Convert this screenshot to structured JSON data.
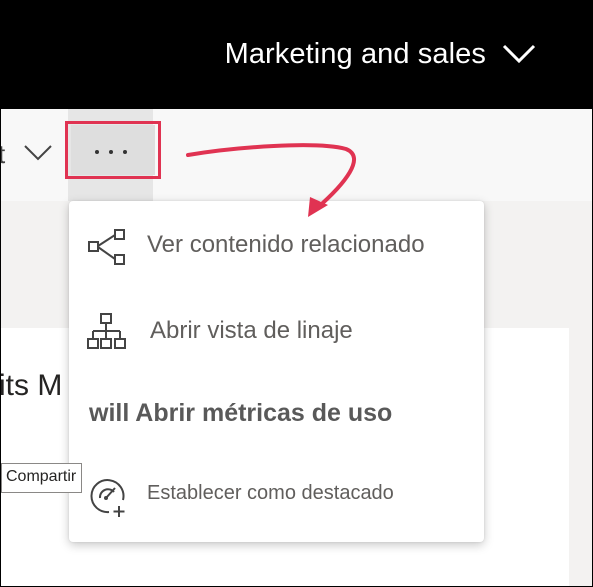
{
  "header": {
    "workspace_title": "Marketing and sales",
    "workspace_chevron_icon": "chevron-down-icon"
  },
  "toolbar": {
    "partial_text": "t",
    "more_options_icon": "ellipsis-icon",
    "chevron_icon": "chevron-down-icon"
  },
  "report": {
    "title_partial": "its M"
  },
  "tooltip": {
    "text": "Compartir"
  },
  "menu": {
    "items": [
      {
        "label": "Ver contenido relacionado",
        "icon": "share-network-icon"
      },
      {
        "label": "Abrir vista de linaje",
        "icon": "hierarchy-icon"
      },
      {
        "label": "will Abrir métricas de uso",
        "icon": ""
      },
      {
        "label": "Establecer como destacado",
        "icon": "gauge-add-icon"
      }
    ]
  },
  "colors": {
    "header_bg": "#000000",
    "highlight": "#e03352",
    "menu_text": "#605e5c"
  }
}
